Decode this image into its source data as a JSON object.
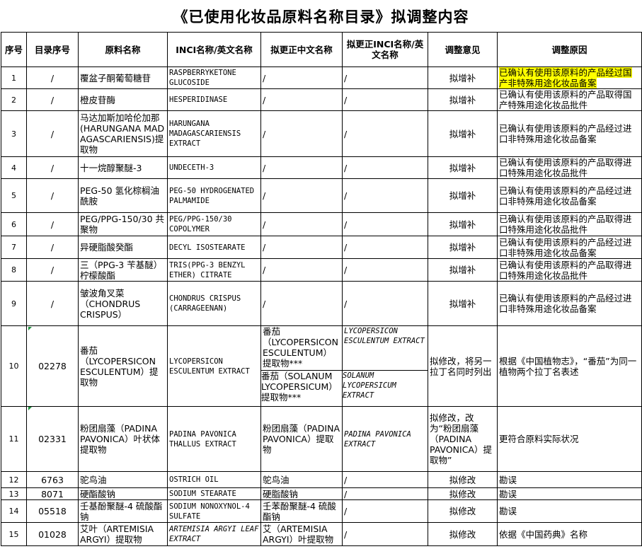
{
  "title": "《已使用化妆品原料名称目录》拟调整内容",
  "columns": [
    "序号",
    "目录序号",
    "原料名称",
    "INCI名称/英文名称",
    "拟更正中文名称",
    "拟更正INCI名称/英文名称",
    "调整意见",
    "调整原因"
  ],
  "rows": [
    {
      "no": "1",
      "cat": "/",
      "name": "覆盆子酮葡萄糖苷",
      "inci": "RASPBERRYKETONE GLUCOSIDE",
      "cn_fix": "/",
      "inci_fix": "/",
      "opinion": "拟增补",
      "reason": "已确认有使用该原料的产品经过国产非特殊用途化妆品备案",
      "highlight": true
    },
    {
      "no": "2",
      "cat": "/",
      "name": "橙皮苷酶",
      "inci": "HESPERIDINASE",
      "cn_fix": "/",
      "inci_fix": "/",
      "opinion": "拟增补",
      "reason": "已确认有使用该原料的产品取得国产特殊用途化妆品批件"
    },
    {
      "no": "3",
      "cat": "/",
      "name": "马达加斯加哈伦加那(HARUNGANA MADAGASCARIENSIS)提取物",
      "inci": "HARUNGANA MADAGASCARIENSIS EXTRACT",
      "cn_fix": "/",
      "inci_fix": "/",
      "opinion": "拟增补",
      "reason": "已确认有使用该原料的产品经过进口非特殊用途化妆品备案"
    },
    {
      "no": "4",
      "cat": "/",
      "name": "十一烷醇聚醚-3",
      "inci": "UNDECETH-3",
      "cn_fix": "/",
      "inci_fix": "/",
      "opinion": "拟增补",
      "reason": "已确认有使用该原料的产品取得进口特殊用途化妆品批件"
    },
    {
      "no": "5",
      "cat": "/",
      "name": "PEG-50 氢化棕榈油酰胺",
      "inci": "PEG-50 HYDROGENATED PALMAMIDE",
      "cn_fix": "/",
      "inci_fix": "/",
      "opinion": "拟增补",
      "reason": "已确认有使用该原料的产品经过进口非特殊用途化妆品备案"
    },
    {
      "no": "6",
      "cat": "/",
      "name": "PEG/PPG-150/30 共聚物",
      "inci": "PEG/PPG-150/30 COPOLYMER",
      "cn_fix": "/",
      "inci_fix": "/",
      "opinion": "拟增补",
      "reason": "已确认有使用该原料的产品取得进口特殊用途化妆品批件"
    },
    {
      "no": "7",
      "cat": "/",
      "name": "异硬脂酸癸酯",
      "inci": "DECYL ISOSTEARATE",
      "cn_fix": "/",
      "inci_fix": "/",
      "opinion": "拟增补",
      "reason": "已确认有使用该原料的产品经过进口非特殊用途化妆品备案"
    },
    {
      "no": "8",
      "cat": "/",
      "name": "三（PPG-3 苄基醚）柠檬酸酯",
      "inci": "TRIS(PPG-3 BENZYL ETHER) CITRATE",
      "cn_fix": "/",
      "inci_fix": "/",
      "opinion": "拟增补",
      "reason": "已确认有使用该原料的产品取得进口特殊用途化妆品批件"
    },
    {
      "no": "9",
      "cat": "/",
      "name": "皱波角叉菜（CHONDRUS CRISPUS）",
      "inci": "CHONDRUS CRISPUS (CARRAGEENAN)",
      "cn_fix": "/",
      "inci_fix": "/",
      "opinion": "拟增补",
      "reason": "已确认有使用该原料的产品经过进口非特殊用途化妆品备案"
    },
    {
      "no": "10",
      "cat": "02278",
      "name": "番茄（LYCOPERSICON ESCULENTUM）提取物",
      "inci": "LYCOPERSICON ESCULENTUM EXTRACT",
      "cn_fix": "番茄（LYCOPERSICON ESCULENTUM）提取物***",
      "cn_fix2": "番茄（SOLANUM LYCOPERSICUM）提取物***",
      "inci_fix": "LYCOPERSICON ESCULENTUM EXTRACT",
      "inci_fix2": "SOLANUM LYCOPERSICUM EXTRACT",
      "opinion": "拟修改，将另一拉丁名同时列出",
      "reason": "根据《中国植物志》，“番茄”为同一植物两个拉丁名表述"
    },
    {
      "no": "11",
      "cat": "02331",
      "name": "粉团扇藻（PADINA PAVONICA）叶状体提取物",
      "inci": "PADINA PAVONICA THALLUS EXTRACT",
      "cn_fix": "粉团扇藻（PADINA PAVONICA）提取物",
      "inci_fix": "PADINA PAVONICA EXTRACT",
      "opinion": "拟修改，改为“粉团扇藻（PADINA PAVONICA）提取物”",
      "reason": "更符合原料实际状况"
    },
    {
      "no": "12",
      "cat": "6763",
      "name": "驼鸟油",
      "inci": "OSTRICH OIL",
      "cn_fix": "鸵鸟油",
      "inci_fix": "/",
      "opinion": "拟修改",
      "reason": "勘误"
    },
    {
      "no": "13",
      "cat": "8071",
      "name": "硬酯酸钠",
      "inci": "SODIUM STEARATE",
      "cn_fix": "硬脂酸钠",
      "inci_fix": "/",
      "opinion": "拟修改",
      "reason": "勘误"
    },
    {
      "no": "14",
      "cat": "05518",
      "name": "壬基酚聚醚-4 硫酸酯钠",
      "inci": "SODIUM NONOXYNOL-4 SULFATE",
      "cn_fix": "壬苯酚聚醚-4 硫酸酯钠",
      "inci_fix": "/",
      "opinion": "拟修改",
      "reason": "勘误"
    },
    {
      "no": "15",
      "cat": "01028",
      "name": "艾叶（ARTEMISIA ARGYI）提取物",
      "inci": "ARTEMISIA ARGYI LEAF EXTRACT",
      "cn_fix": "艾（ARTEMISIA ARGYI）叶提取物",
      "inci_fix": "/",
      "opinion": "拟修改",
      "reason": "依据《中国药典》名称"
    }
  ]
}
